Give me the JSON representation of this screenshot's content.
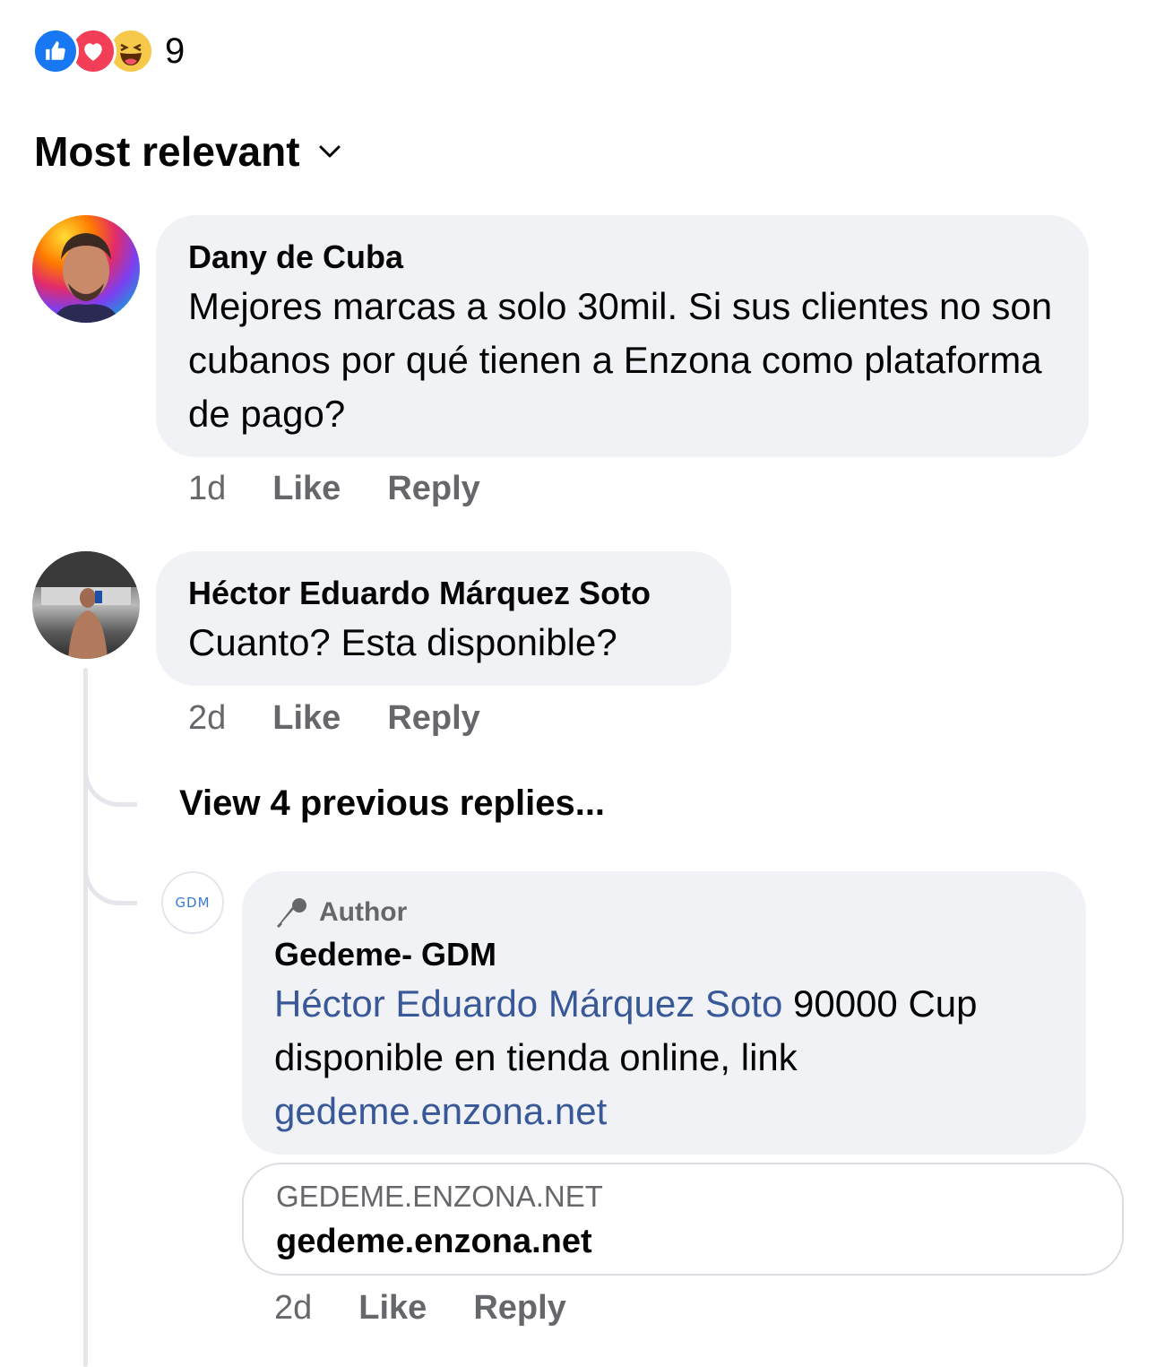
{
  "reactions": {
    "icons": [
      "like-icon",
      "love-icon",
      "haha-icon"
    ],
    "count": "9"
  },
  "sort": {
    "label": "Most relevant"
  },
  "comments": [
    {
      "author": "Dany de Cuba",
      "text": "Mejores marcas a solo 30mil. Si sus clientes no son cubanos por qué tienen a Enzona como plataforma de pago?",
      "time": "1d",
      "like": "Like",
      "reply": "Reply"
    },
    {
      "author": "Héctor Eduardo Márquez Soto",
      "text": "Cuanto? Esta disponible?",
      "time": "2d",
      "like": "Like",
      "reply": "Reply",
      "view_previous": "View 4 previous replies...",
      "replies": [
        {
          "avatar_text": "GDM",
          "badge": "Author",
          "author": "Gedeme- GDM",
          "mention": "Héctor Eduardo Márquez Soto",
          "text": " 90000 Cup disponible en tienda online, link ",
          "link": "gedeme.enzona.net",
          "preview": {
            "domain": "GEDEME.ENZONA.NET",
            "title": "gedeme.enzona.net"
          },
          "time": "2d",
          "like": "Like",
          "reply": "Reply"
        }
      ]
    }
  ],
  "colors": {
    "bubble": "#f0f2f5",
    "link": "#385898",
    "secondary_text": "#65676b",
    "like_blue": "#1877f2",
    "love_red": "#f33e58",
    "haha_yellow": "#f7c94b"
  }
}
